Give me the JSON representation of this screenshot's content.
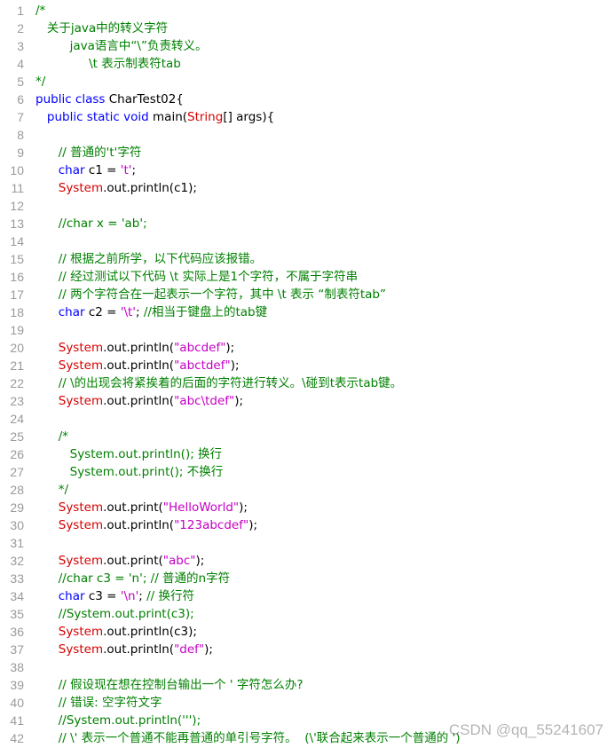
{
  "colors": {
    "keyword": "#0000ff",
    "system": "#d40000",
    "string": "#c400c4",
    "comment": "#008000",
    "plain": "#000000",
    "line_number": "#9a9a9a",
    "background": "#ffffff"
  },
  "lines": [
    {
      "n": "1",
      "t": [
        [
          "com",
          "/*"
        ]
      ]
    },
    {
      "n": "2",
      "t": [
        [
          "com",
          "   关于java中的转义字符"
        ]
      ]
    },
    {
      "n": "3",
      "t": [
        [
          "com",
          "         java语言中“\\”负责转义。"
        ]
      ]
    },
    {
      "n": "4",
      "t": [
        [
          "com",
          "              \\t 表示制表符tab"
        ]
      ]
    },
    {
      "n": "5",
      "t": [
        [
          "com",
          "*/"
        ]
      ]
    },
    {
      "n": "6",
      "t": [
        [
          "kw",
          "public class "
        ],
        [
          "pl",
          "CharTest02{"
        ]
      ]
    },
    {
      "n": "7",
      "t": [
        [
          "kw",
          "   public static void "
        ],
        [
          "pl",
          "main("
        ],
        [
          "sys",
          "String"
        ],
        [
          "pl",
          "[] args){"
        ]
      ]
    },
    {
      "n": "8",
      "t": []
    },
    {
      "n": "9",
      "t": [
        [
          "com",
          "      // 普通的't'字符"
        ]
      ]
    },
    {
      "n": "10",
      "t": [
        [
          "kw",
          "      char "
        ],
        [
          "pl",
          "c1 = "
        ],
        [
          "str",
          "'t'"
        ],
        [
          "pl",
          ";"
        ]
      ]
    },
    {
      "n": "11",
      "t": [
        [
          "sys",
          "      System"
        ],
        [
          "pl",
          ".out.println(c1);"
        ]
      ]
    },
    {
      "n": "12",
      "t": []
    },
    {
      "n": "13",
      "t": [
        [
          "com",
          "      //char x = 'ab';"
        ]
      ]
    },
    {
      "n": "14",
      "t": []
    },
    {
      "n": "15",
      "t": [
        [
          "com",
          "      // 根据之前所学，以下代码应该报错。"
        ]
      ]
    },
    {
      "n": "16",
      "t": [
        [
          "com",
          "      // 经过测试以下代码 \\t 实际上是1个字符，不属于字符串"
        ]
      ]
    },
    {
      "n": "17",
      "t": [
        [
          "com",
          "      // 两个字符合在一起表示一个字符，其中 \\t 表示 “制表符tab”"
        ]
      ]
    },
    {
      "n": "18",
      "t": [
        [
          "kw",
          "      char "
        ],
        [
          "pl",
          "c2 = "
        ],
        [
          "str",
          "'\\t'"
        ],
        [
          "pl",
          "; "
        ],
        [
          "com",
          "//相当于键盘上的tab键"
        ]
      ]
    },
    {
      "n": "19",
      "t": []
    },
    {
      "n": "20",
      "t": [
        [
          "sys",
          "      System"
        ],
        [
          "pl",
          ".out.println("
        ],
        [
          "str",
          "\"abcdef\""
        ],
        [
          "pl",
          ");"
        ]
      ]
    },
    {
      "n": "21",
      "t": [
        [
          "sys",
          "      System"
        ],
        [
          "pl",
          ".out.println("
        ],
        [
          "str",
          "\"abctdef\""
        ],
        [
          "pl",
          ");"
        ]
      ]
    },
    {
      "n": "22",
      "t": [
        [
          "com",
          "      // \\的出现会将紧挨着的后面的字符进行转义。\\碰到t表示tab键。"
        ]
      ]
    },
    {
      "n": "23",
      "t": [
        [
          "sys",
          "      System"
        ],
        [
          "pl",
          ".out.println("
        ],
        [
          "str",
          "\"abc\\tdef\""
        ],
        [
          "pl",
          ");"
        ]
      ]
    },
    {
      "n": "24",
      "t": []
    },
    {
      "n": "25",
      "t": [
        [
          "com",
          "      /*"
        ]
      ]
    },
    {
      "n": "26",
      "t": [
        [
          "com",
          "         System.out.println(); 换行"
        ]
      ]
    },
    {
      "n": "27",
      "t": [
        [
          "com",
          "         System.out.print(); 不换行"
        ]
      ]
    },
    {
      "n": "28",
      "t": [
        [
          "com",
          "      */"
        ]
      ]
    },
    {
      "n": "29",
      "t": [
        [
          "sys",
          "      System"
        ],
        [
          "pl",
          ".out.print("
        ],
        [
          "str",
          "\"HelloWorld\""
        ],
        [
          "pl",
          ");"
        ]
      ]
    },
    {
      "n": "30",
      "t": [
        [
          "sys",
          "      System"
        ],
        [
          "pl",
          ".out.println("
        ],
        [
          "str",
          "\"123abcdef\""
        ],
        [
          "pl",
          ");"
        ]
      ]
    },
    {
      "n": "31",
      "t": []
    },
    {
      "n": "32",
      "t": [
        [
          "sys",
          "      System"
        ],
        [
          "pl",
          ".out.print("
        ],
        [
          "str",
          "\"abc\""
        ],
        [
          "pl",
          ");"
        ]
      ]
    },
    {
      "n": "33",
      "t": [
        [
          "com",
          "      //char c3 = 'n'; // 普通的n字符"
        ]
      ]
    },
    {
      "n": "34",
      "t": [
        [
          "kw",
          "      char "
        ],
        [
          "pl",
          "c3 = "
        ],
        [
          "str",
          "'\\n'"
        ],
        [
          "pl",
          "; "
        ],
        [
          "com",
          "// 换行符"
        ]
      ]
    },
    {
      "n": "35",
      "t": [
        [
          "com",
          "      //System.out.print(c3);"
        ]
      ]
    },
    {
      "n": "36",
      "t": [
        [
          "sys",
          "      System"
        ],
        [
          "pl",
          ".out.println(c3);"
        ]
      ]
    },
    {
      "n": "37",
      "t": [
        [
          "sys",
          "      System"
        ],
        [
          "pl",
          ".out.println("
        ],
        [
          "str",
          "\"def\""
        ],
        [
          "pl",
          ");"
        ]
      ]
    },
    {
      "n": "38",
      "t": []
    },
    {
      "n": "39",
      "t": [
        [
          "com",
          "      // 假设现在想在控制台输出一个 ' 字符怎么办?"
        ]
      ]
    },
    {
      "n": "40",
      "t": [
        [
          "com",
          "      // 错误: 空字符文字"
        ]
      ]
    },
    {
      "n": "41",
      "t": [
        [
          "com",
          "      //System.out.println(''');"
        ]
      ]
    },
    {
      "n": "42",
      "t": [
        [
          "com",
          "      // \\' 表示一个普通不能再普通的单引号字符。  (\\'联合起来表示一个普通的 ')"
        ]
      ]
    }
  ],
  "watermark": "CSDN @qq_55241607"
}
